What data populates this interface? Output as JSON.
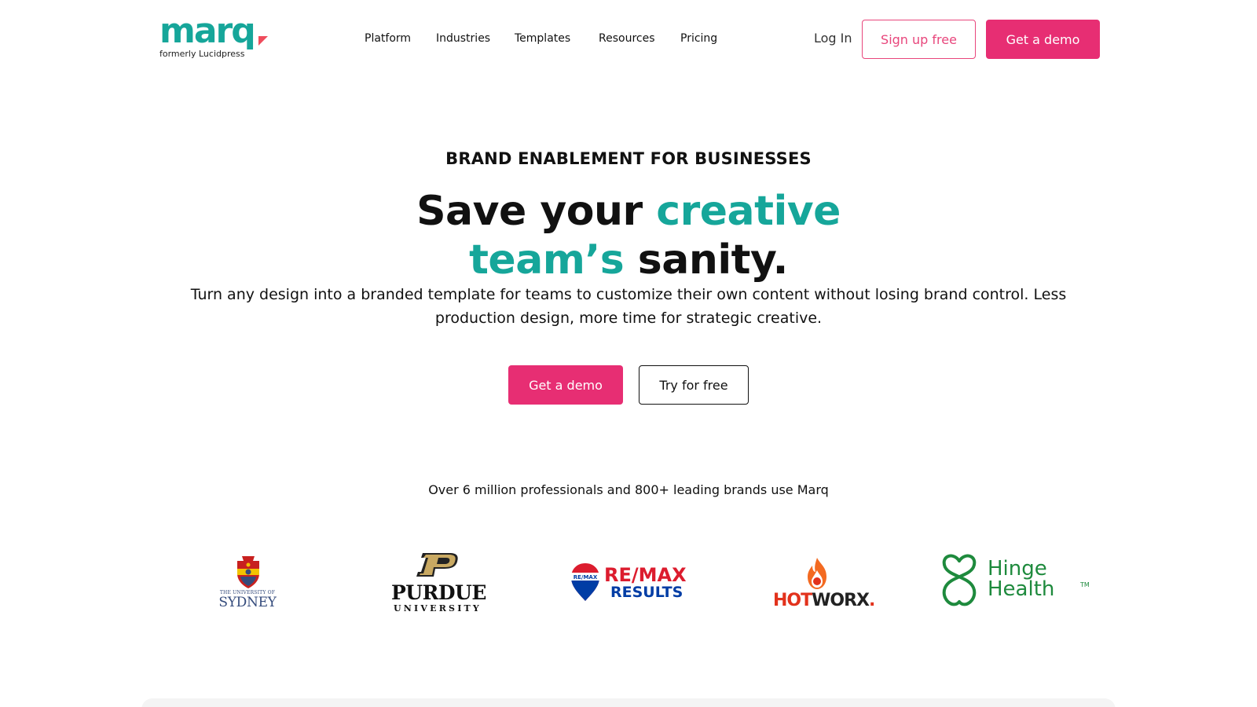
{
  "brand": {
    "logo_text": "marq",
    "logo_subtitle": "formerly Lucidpress",
    "teal": "#16a69a",
    "pink": "#e72e73"
  },
  "nav": {
    "items": [
      {
        "label": "Platform"
      },
      {
        "label": "Industries"
      },
      {
        "label": "Templates"
      },
      {
        "label": "Resources"
      },
      {
        "label": "Pricing"
      }
    ],
    "login_label": "Log In",
    "signup_label": "Sign up free",
    "demo_label": "Get a demo"
  },
  "hero": {
    "eyebrow": "BRAND ENABLEMENT FOR BUSINESSES",
    "headline_part1": "Save your ",
    "headline_teal1": "creative",
    "headline_teal2": "team’s",
    "headline_part2": " sanity.",
    "lede": "Turn any design into a branded template for teams to customize their own content without losing brand control. Less production design, more time for strategic creative.",
    "cta_primary": "Get a demo",
    "cta_secondary": "Try for free"
  },
  "social_proof": {
    "text": "Over 6 million professionals and 800+ leading brands use Marq",
    "logos": [
      {
        "name": "University of Sydney",
        "line1": "THE UNIVERSITY OF",
        "line2": "SYDNEY"
      },
      {
        "name": "Purdue University",
        "line1": "PURDUE",
        "line2": "UNIVERSITY"
      },
      {
        "name": "RE/MAX Results",
        "line1": "RE/MAX",
        "line2": "RESULTS",
        "balloon_text": "RE/MAX"
      },
      {
        "name": "HOTWORX",
        "line1_hot": "H",
        "line1_o": "O",
        "line1_t": "T",
        "line1_rest": "WORX",
        "line1_dot": "."
      },
      {
        "name": "Hinge Health",
        "line1": "Hinge",
        "line2": "Health",
        "tm": "TM"
      }
    ]
  }
}
